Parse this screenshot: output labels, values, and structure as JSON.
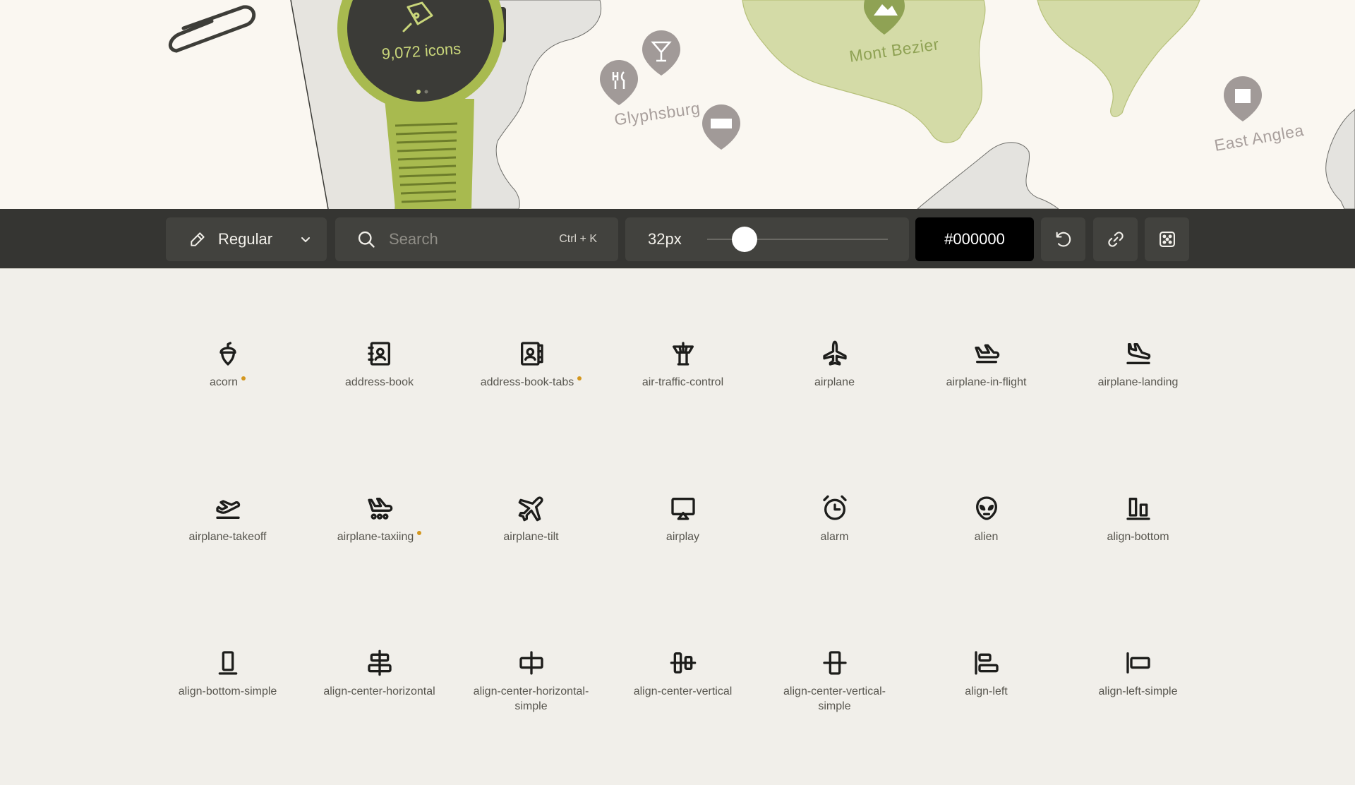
{
  "hero": {
    "watch_count": "9,072 icons",
    "places": [
      {
        "label": "Glyphsburg"
      },
      {
        "label": "Mont Bezier"
      },
      {
        "label": "East Anglea"
      }
    ],
    "colors": {
      "land_green": "#d4dba7",
      "dark_green": "#8fa254",
      "watch_band": "#a8ba4f",
      "pin": "#a19a98"
    }
  },
  "toolbar": {
    "weight_label": "Regular",
    "search_placeholder": "Search",
    "search_shortcut": "Ctrl + K",
    "size_value": "32px",
    "size_slider_fraction": 0.16,
    "color_value": "#000000",
    "icons": [
      "pencil-icon",
      "chevron-down-icon",
      "search-icon",
      "undo-icon",
      "link-icon",
      "dice-icon"
    ]
  },
  "icons": [
    {
      "name": "acorn",
      "new": true
    },
    {
      "name": "address-book",
      "new": false
    },
    {
      "name": "address-book-tabs",
      "new": true
    },
    {
      "name": "air-traffic-control",
      "new": false
    },
    {
      "name": "airplane",
      "new": false
    },
    {
      "name": "airplane-in-flight",
      "new": false
    },
    {
      "name": "airplane-landing",
      "new": false
    },
    {
      "name": "airplane-takeoff",
      "new": false
    },
    {
      "name": "airplane-taxiing",
      "new": true
    },
    {
      "name": "airplane-tilt",
      "new": false
    },
    {
      "name": "airplay",
      "new": false
    },
    {
      "name": "alarm",
      "new": false
    },
    {
      "name": "alien",
      "new": false
    },
    {
      "name": "align-bottom",
      "new": false
    },
    {
      "name": "align-bottom-simple",
      "new": false
    },
    {
      "name": "align-center-horizontal",
      "new": false
    },
    {
      "name": "align-center-horizontal-simple",
      "new": false
    },
    {
      "name": "align-center-vertical",
      "new": false
    },
    {
      "name": "align-center-vertical-simple",
      "new": false
    },
    {
      "name": "align-left",
      "new": false
    },
    {
      "name": "align-left-simple",
      "new": false
    }
  ],
  "new_dot_color": "#d4971f"
}
